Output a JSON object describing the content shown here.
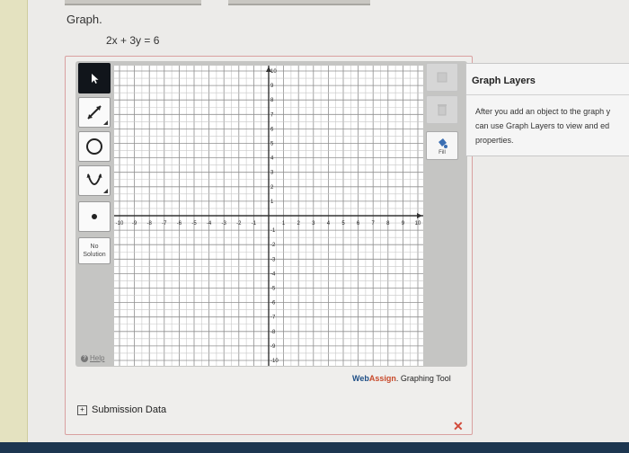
{
  "question": {
    "label": "Graph.",
    "equation": "2x + 3y = 6"
  },
  "toolbox": {
    "tools": [
      {
        "name": "pointer-tool",
        "icon": "pointer-arrow-icon",
        "active": true
      },
      {
        "name": "line-tool",
        "icon": "line-icon"
      },
      {
        "name": "circle-tool",
        "icon": "circle-icon"
      },
      {
        "name": "parabola-tool",
        "icon": "parabola-icon"
      },
      {
        "name": "point-tool",
        "icon": "point-icon"
      }
    ],
    "no_solution_line1": "No",
    "no_solution_line2": "Solution",
    "help_label": "Help"
  },
  "graph": {
    "x_range": [
      -10,
      10
    ],
    "y_range": [
      -10,
      10
    ],
    "x_ticks": [
      "-10",
      "-9",
      "-8",
      "-7",
      "-6",
      "-5",
      "-4",
      "-3",
      "-2",
      "-1",
      "1",
      "2",
      "3",
      "4",
      "5",
      "6",
      "7",
      "8",
      "9",
      "10"
    ],
    "y_ticks": [
      "10",
      "9",
      "8",
      "7",
      "6",
      "5",
      "4",
      "3",
      "2",
      "1",
      "-1",
      "-2",
      "-3",
      "-4",
      "-5",
      "-6",
      "-7",
      "-8",
      "-9",
      "-10"
    ],
    "grid": true
  },
  "side_tools": {
    "fill_label": "Fill"
  },
  "branding": {
    "web": "Web",
    "assign": "Assign",
    "suffix": ". Graphing Tool"
  },
  "submission": {
    "label": "Submission Data"
  },
  "close_symbol": "✕",
  "layers": {
    "title": "Graph Layers",
    "line1": "After you add an object to the graph y",
    "line2": "can use Graph Layers to view and ed",
    "line3": "properties."
  },
  "colors": {
    "accent_red": "#d24a3a",
    "brand_blue": "#1f4f86",
    "brand_orange": "#c84a2b",
    "toolbar_dark": "#11151b"
  }
}
